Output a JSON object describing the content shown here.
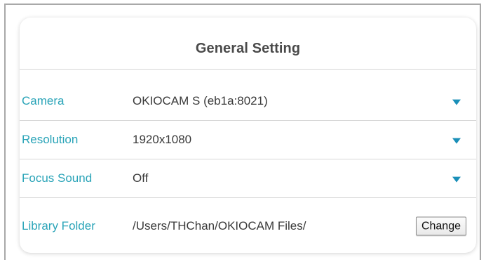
{
  "panel": {
    "title": "General Setting"
  },
  "settings": {
    "camera": {
      "label": "Camera",
      "value": "OKIOCAM S (eb1a:8021)",
      "icon": "caret-down-icon"
    },
    "resolution": {
      "label": "Resolution",
      "value": "1920x1080",
      "icon": "caret-down-icon"
    },
    "focus_sound": {
      "label": "Focus Sound",
      "value": "Off",
      "icon": "caret-down-icon"
    },
    "library_folder": {
      "label": "Library Folder",
      "value": "/Users/THChan/OKIOCAM Files/",
      "button_label": "Change"
    }
  },
  "colors": {
    "label_accent": "#2aa4b8",
    "dropdown_arrow": "#1a8fb8",
    "title_text": "#4a4a4a"
  }
}
